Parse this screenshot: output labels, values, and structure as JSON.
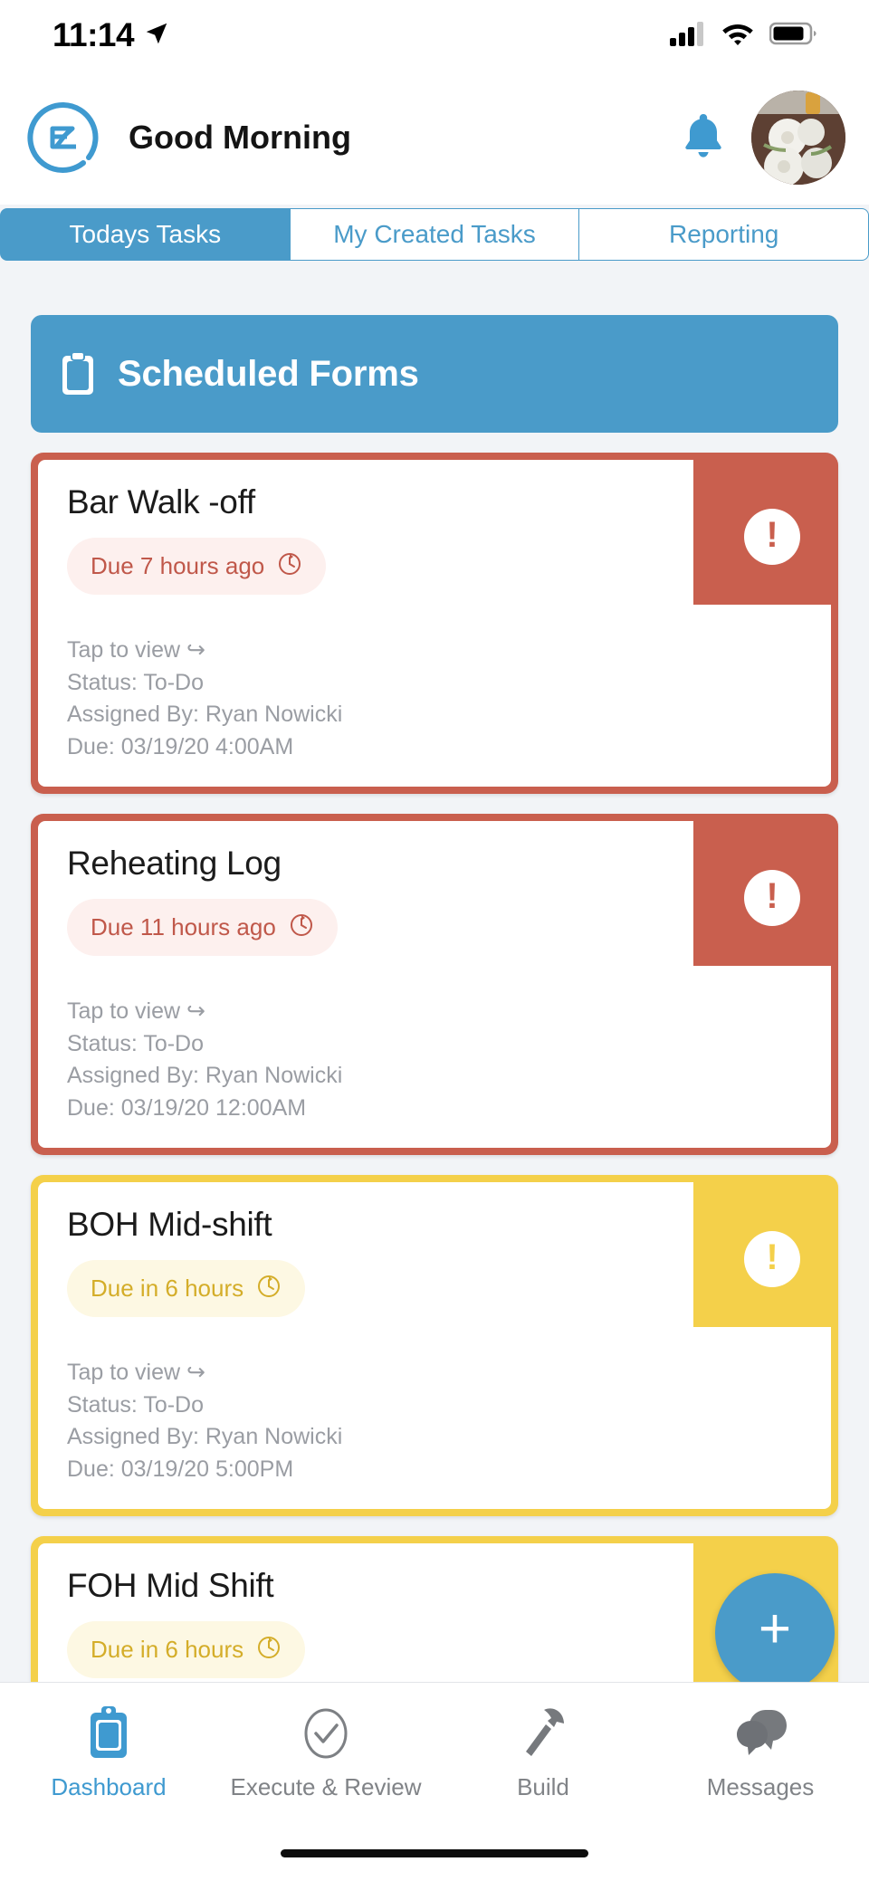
{
  "status_bar": {
    "time": "11:14",
    "icons": [
      "location-arrow-icon",
      "cellular-signal-icon",
      "wifi-icon",
      "battery-icon"
    ]
  },
  "header": {
    "logo": "ez-logo",
    "greeting": "Good Morning",
    "bell": "bell-icon",
    "avatar": "user-avatar"
  },
  "tabs": [
    {
      "label": "Todays Tasks",
      "active": true
    },
    {
      "label": "My Created Tasks",
      "active": false
    },
    {
      "label": "Reporting",
      "active": false
    }
  ],
  "section": {
    "icon": "clipboard-icon",
    "title": "Scheduled Forms"
  },
  "tasks": [
    {
      "title": "Bar Walk -off",
      "due_pill": "Due 7 hours ago",
      "severity": "red",
      "tap": "Tap to view ↪",
      "status": "Status: To-Do",
      "assigned": "Assigned By: Ryan Nowicki",
      "due": "Due: 03/19/20 4:00AM",
      "badge": "alert-icon"
    },
    {
      "title": "Reheating Log",
      "due_pill": "Due 11 hours ago",
      "severity": "red",
      "tap": "Tap to view ↪",
      "status": "Status: To-Do",
      "assigned": "Assigned By: Ryan Nowicki",
      "due": "Due: 03/19/20 12:00AM",
      "badge": "alert-icon"
    },
    {
      "title": "BOH Mid-shift",
      "due_pill": "Due in 6 hours",
      "severity": "yellow",
      "tap": "Tap to view ↪",
      "status": "Status: To-Do",
      "assigned": "Assigned By: Ryan Nowicki",
      "due": "Due: 03/19/20 5:00PM",
      "badge": "alert-icon"
    },
    {
      "title": "FOH Mid Shift",
      "due_pill": "Due in 6 hours",
      "severity": "yellow",
      "tap": "",
      "status": "",
      "assigned": "",
      "due": "",
      "badge": "alert-icon"
    }
  ],
  "fab": {
    "label": "+",
    "name": "add-task-button"
  },
  "bottom_nav": [
    {
      "label": "Dashboard",
      "icon": "clipboard-icon",
      "active": true
    },
    {
      "label": "Execute & Review",
      "icon": "check-circle-icon",
      "active": false
    },
    {
      "label": "Build",
      "icon": "hammer-icon",
      "active": false
    },
    {
      "label": "Messages",
      "icon": "chat-bubbles-icon",
      "active": false
    }
  ],
  "colors": {
    "brand_blue": "#4a9bc9",
    "overdue_red": "#c95f4e",
    "upcoming_yellow": "#f4d04a",
    "page_bg": "#f2f4f7",
    "muted_text": "#9a9da3"
  }
}
